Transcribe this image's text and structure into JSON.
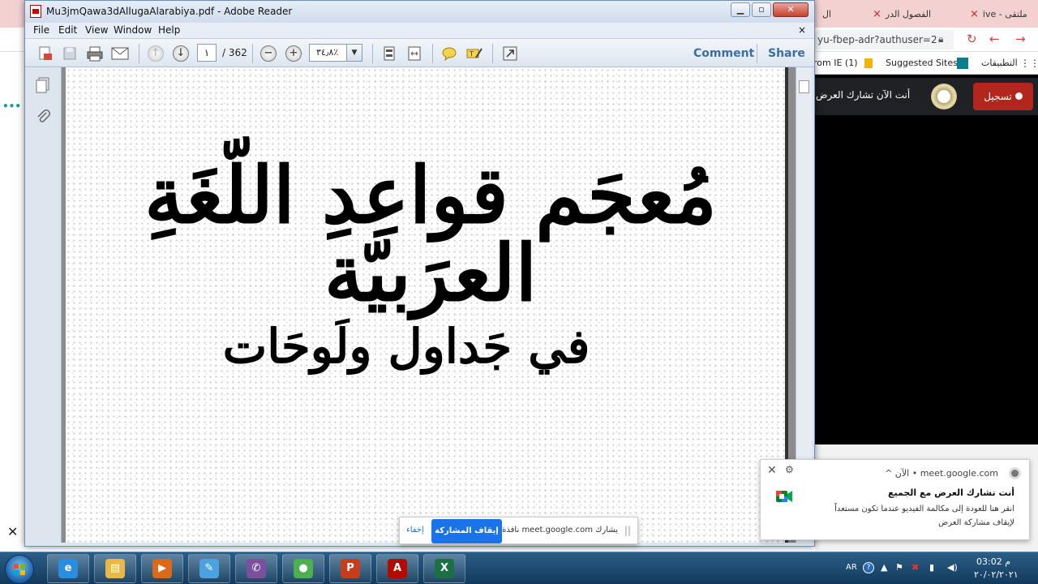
{
  "chrome": {
    "tabs": [
      {
        "label": "ملتقى - ive",
        "close": "×"
      },
      {
        "label": "الفصول الدر",
        "close": "×"
      },
      {
        "label": "ال",
        "close": ""
      }
    ],
    "omnibox_text": "yu-fbep-adr?authuser=2",
    "bookmarks": {
      "apps_label": "التطبيقات",
      "suggested_sites": "Suggested Sites",
      "from_ie": "rom IE (1)"
    },
    "meet_presenting": "أنت الآن تشارك العرض",
    "record_label": "تسجيل",
    "left_partial": "ری",
    "left_dots": "•••"
  },
  "reader": {
    "window_title": "Mu3jmQawa3dAllugaAlarabiya.pdf - Adobe Reader",
    "menu": [
      "File",
      "Edit",
      "View",
      "Window",
      "Help"
    ],
    "doc_close": "×",
    "page_current": "١",
    "page_total": "/ 362",
    "zoom": "٣٤٫٨٪",
    "comment_label": "Comment",
    "share_label": "Share",
    "page_title_ar": "مُعجَم قواعِدِ اللّغَةِ العرَبيّة",
    "page_subtitle_ar": "في جَداول ولَوحَات"
  },
  "notification": {
    "source": "meet.google.com  •  الآن ^",
    "title": "أنت تشارك العرض مع الجميع",
    "body": "انقر هنا للعودة إلى مكالمة الفيديو عندما تكون مستعداً لإيقاف مشاركة العرض"
  },
  "sharebar": {
    "text": "يشارك meet.google.com نافذة",
    "stop_label": "إيقاف المشاركة",
    "hide_label": "إخفاء",
    "handle": "||"
  },
  "taskbar": {
    "apps": [
      {
        "name": "internet-explorer",
        "glyph": "e",
        "color": "#2b8de0"
      },
      {
        "name": "file-explorer",
        "glyph": "▤",
        "color": "#e8b949"
      },
      {
        "name": "media-player",
        "glyph": "▶",
        "color": "#d86a1a"
      },
      {
        "name": "paint",
        "glyph": "✎",
        "color": "#4aa3df"
      },
      {
        "name": "viber",
        "glyph": "✆",
        "color": "#7b519d"
      },
      {
        "name": "chrome",
        "glyph": "●",
        "color": "#4caf50"
      },
      {
        "name": "powerpoint",
        "glyph": "P",
        "color": "#c43e1c"
      },
      {
        "name": "acrobat",
        "glyph": "A",
        "color": "#b30b00"
      },
      {
        "name": "excel",
        "glyph": "X",
        "color": "#1d7044"
      }
    ],
    "language": "AR",
    "time": "م 03:02",
    "date": "٢٠/٠٢/٢٠٢١"
  }
}
